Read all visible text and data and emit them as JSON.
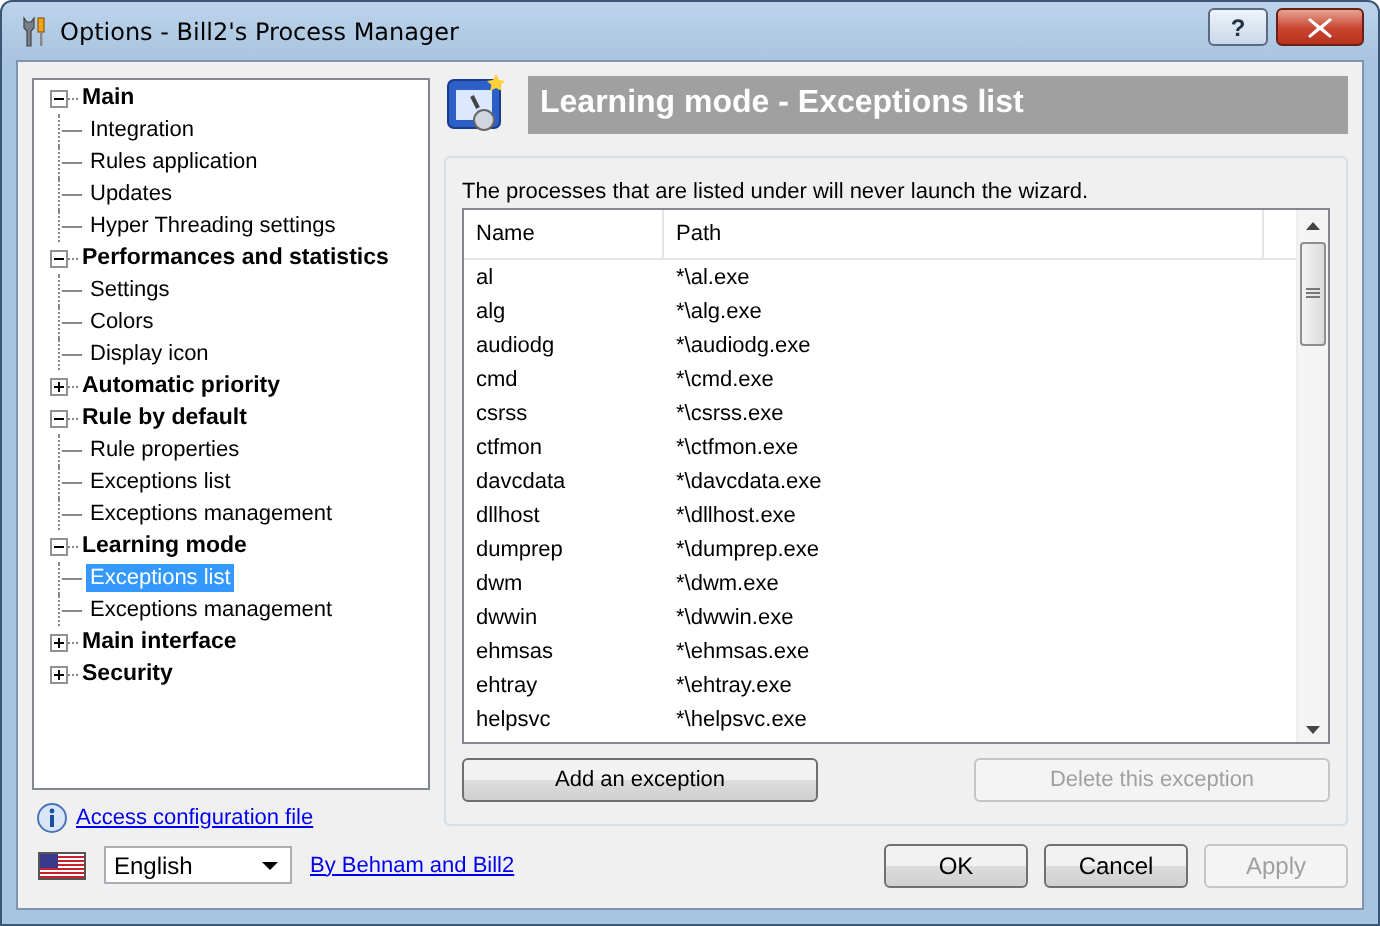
{
  "window": {
    "title": "Options - Bill2's Process Manager",
    "help": "?"
  },
  "tree": [
    {
      "label": "Main",
      "expanded": true,
      "children": [
        {
          "label": "Integration",
          "selected": false
        },
        {
          "label": "Rules application",
          "selected": false
        },
        {
          "label": "Updates",
          "selected": false
        },
        {
          "label": "Hyper Threading settings",
          "selected": false
        }
      ]
    },
    {
      "label": "Performances and statistics",
      "expanded": true,
      "children": [
        {
          "label": "Settings",
          "selected": false
        },
        {
          "label": "Colors",
          "selected": false
        },
        {
          "label": "Display icon",
          "selected": false
        }
      ]
    },
    {
      "label": "Automatic priority",
      "expanded": false
    },
    {
      "label": "Rule by default",
      "expanded": true,
      "children": [
        {
          "label": "Rule properties",
          "selected": false
        },
        {
          "label": "Exceptions list",
          "selected": false
        },
        {
          "label": "Exceptions management",
          "selected": false
        }
      ]
    },
    {
      "label": "Learning mode",
      "expanded": true,
      "children": [
        {
          "label": "Exceptions list",
          "selected": true
        },
        {
          "label": "Exceptions management",
          "selected": false
        }
      ]
    },
    {
      "label": "Main interface",
      "expanded": false
    },
    {
      "label": "Security",
      "expanded": false
    }
  ],
  "header": {
    "title": "Learning mode - Exceptions list"
  },
  "description": "The processes that are listed under will never launch the wizard.",
  "table": {
    "columns": [
      "Name",
      "Path"
    ],
    "rows": [
      [
        "al",
        "*\\al.exe"
      ],
      [
        "alg",
        "*\\alg.exe"
      ],
      [
        "audiodg",
        "*\\audiodg.exe"
      ],
      [
        "cmd",
        "*\\cmd.exe"
      ],
      [
        "csrss",
        "*\\csrss.exe"
      ],
      [
        "ctfmon",
        "*\\ctfmon.exe"
      ],
      [
        "davcdata",
        "*\\davcdata.exe"
      ],
      [
        "dllhost",
        "*\\dllhost.exe"
      ],
      [
        "dumprep",
        "*\\dumprep.exe"
      ],
      [
        "dwm",
        "*\\dwm.exe"
      ],
      [
        "dwwin",
        "*\\dwwin.exe"
      ],
      [
        "ehmsas",
        "*\\ehmsas.exe"
      ],
      [
        "ehtray",
        "*\\ehtray.exe"
      ],
      [
        "helpsvc",
        "*\\helpsvc.exe"
      ]
    ]
  },
  "list_buttons": [
    {
      "label": "Add an exception",
      "disabled": false
    },
    {
      "label": "Delete this exception",
      "disabled": true
    }
  ],
  "config_link": "Access configuration file",
  "language": "English",
  "credits_link": "By Behnam and Bill2",
  "dialog_buttons": [
    {
      "label": "OK",
      "disabled": false
    },
    {
      "label": "Cancel",
      "disabled": false
    },
    {
      "label": "Apply",
      "disabled": true
    }
  ]
}
